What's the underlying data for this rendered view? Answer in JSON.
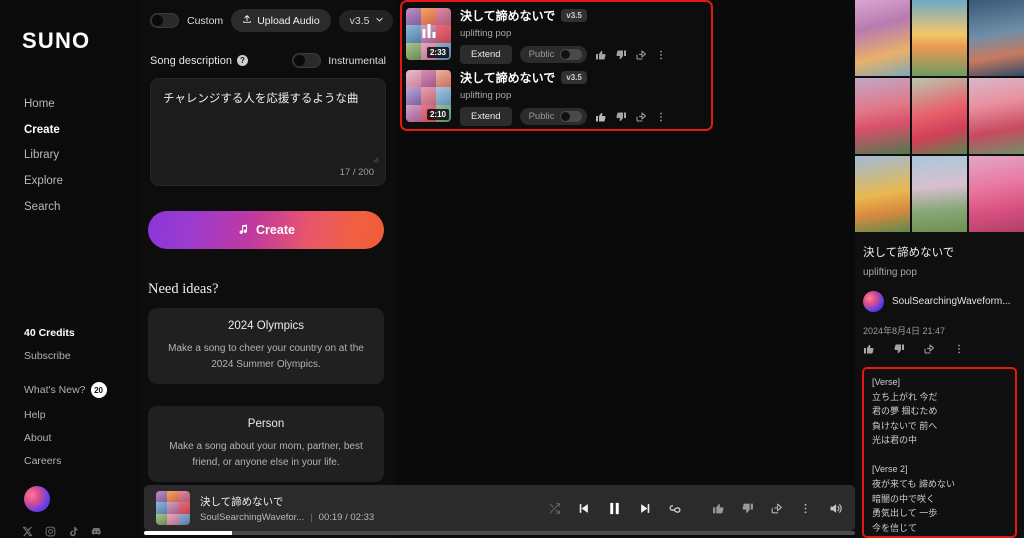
{
  "brand": {
    "logo": "SUNO"
  },
  "sidebar": {
    "nav": [
      {
        "label": "Home",
        "active": false
      },
      {
        "label": "Create",
        "active": true
      },
      {
        "label": "Library",
        "active": false
      },
      {
        "label": "Explore",
        "active": false
      },
      {
        "label": "Search",
        "active": false
      }
    ],
    "credits": "40 Credits",
    "subscribe": "Subscribe",
    "whats_new": "What's New?",
    "whats_new_count": "20",
    "help": "Help",
    "about": "About",
    "careers": "Careers",
    "socials": [
      "x-icon",
      "instagram-icon",
      "tiktok-icon",
      "discord-icon"
    ]
  },
  "create": {
    "custom_label": "Custom",
    "custom_on": false,
    "upload_label": "Upload Audio",
    "version": "v3.5",
    "song_description_label": "Song description",
    "instrumental_label": "Instrumental",
    "instrumental_on": false,
    "description_value": "チャレンジする人を応援するような曲",
    "description_placeholder": "",
    "char_count": "17 / 200",
    "create_button": "Create",
    "need_ideas_title": "Need ideas?",
    "ideas": [
      {
        "title": "2024 Olympics",
        "desc": "Make a song to cheer your country on at the 2024 Summer Olympics."
      },
      {
        "title": "Person",
        "desc": "Make a song about your mom, partner, best friend, or anyone else in your life."
      }
    ]
  },
  "songs": [
    {
      "title": "決して諦めないで",
      "version": "v3.5",
      "style": "uplifting pop",
      "duration": "2:33",
      "extend_label": "Extend",
      "public_label": "Public",
      "playing": true
    },
    {
      "title": "決して諦めないで",
      "version": "v3.5",
      "style": "uplifting pop",
      "duration": "2:10",
      "extend_label": "Extend",
      "public_label": "Public",
      "playing": false
    }
  ],
  "detail": {
    "title": "決して諦めないで",
    "style": "uplifting pop",
    "username": "SoulSearchingWaveform...",
    "date": "2024年8月4日 21:47",
    "lyrics": "[Verse]\n立ち上がれ 今だ\n君の夢 掴むため\n負けないで 前へ\n光は君の中\n\n[Verse 2]\n夜が来ても 諦めない\n暗闇の中で咲く\n勇気出して 一歩\n今を信じて"
  },
  "player": {
    "title": "決して諦めないで",
    "artist": "SoulSearchingWavefor...",
    "current_time": "00:19",
    "total_time": "02:33",
    "time_display": "00:19 / 02:33",
    "progress_percent": 12.4,
    "is_playing": true
  },
  "colors": {
    "highlight_red": "#e21a10",
    "accent_gradient_start": "#8b35d8",
    "accent_gradient_end": "#ef5a3a",
    "background": "#0b0b0b",
    "panel": "#0d0d0d"
  }
}
